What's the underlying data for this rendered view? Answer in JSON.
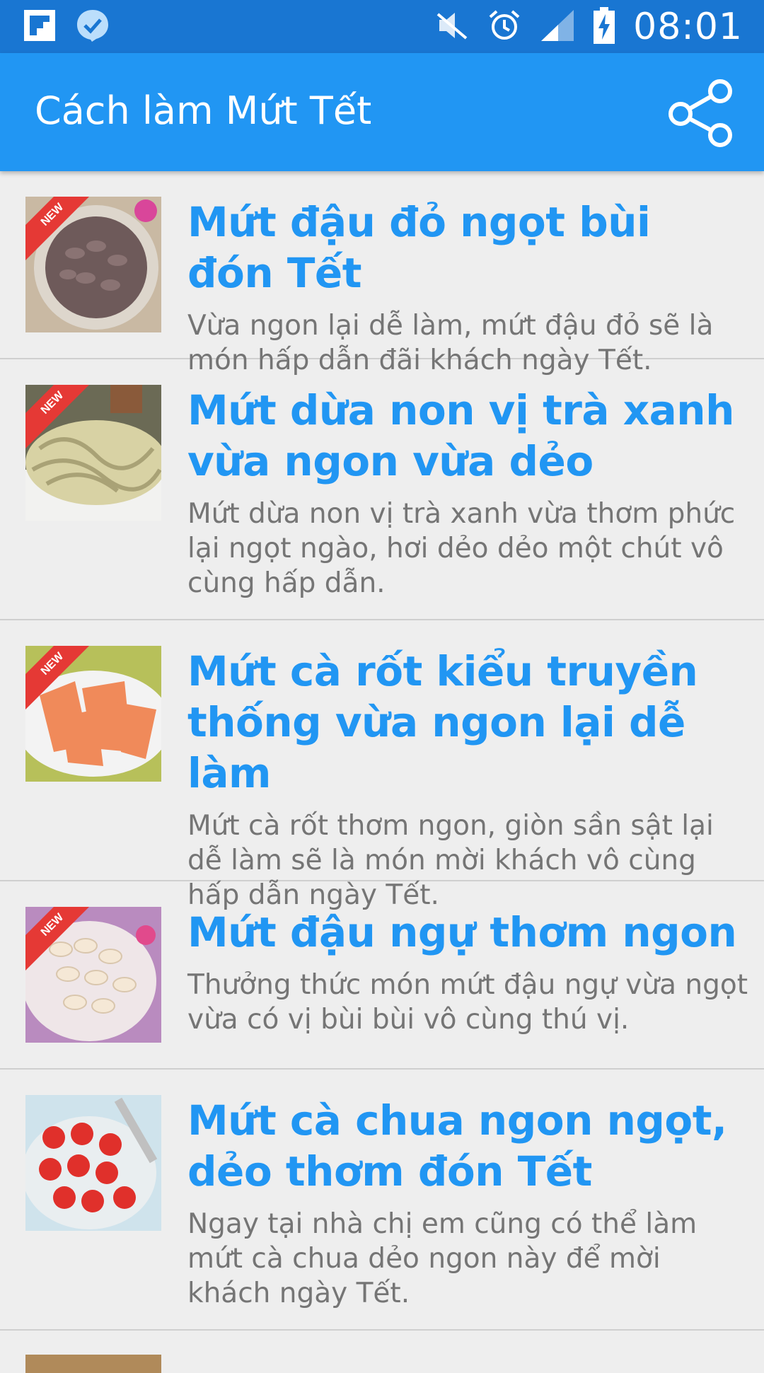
{
  "status_bar": {
    "time": "08:01",
    "left_icons": [
      "flipboard-icon",
      "messenger-check-icon"
    ],
    "right_icons": [
      "mute-icon",
      "alarm-icon",
      "signal-icon",
      "battery-charging-icon"
    ]
  },
  "app_bar": {
    "title": "Cách làm Mứt Tết",
    "share_icon": "share-icon",
    "color": "#2196f3"
  },
  "badge_label": "NEW",
  "items": [
    {
      "title": "Mứt đậu đỏ ngọt bùi đón Tết",
      "description": "Vừa ngon lại dễ làm, mứt đậu đỏ sẽ là món hấp dẫn đãi khách ngày Tết."
    },
    {
      "title": "Mứt dừa non vị trà xanh vừa ngon vừa dẻo",
      "description": "Mứt dừa non vị trà xanh vừa thơm phức lại ngọt ngào, hơi dẻo dẻo một chút vô cùng hấp dẫn."
    },
    {
      "title": "Mứt cà rốt kiểu truyền thống vừa ngon lại dễ làm",
      "description": "Mứt cà rốt thơm ngon, giòn sần sật lại dễ làm sẽ là món mời khách vô cùng hấp dẫn ngày Tết."
    },
    {
      "title": "Mứt đậu ngự thơm ngon",
      "description": "Thưởng thức món mứt đậu ngự vừa ngọt vừa có vị bùi bùi vô cùng thú vị."
    },
    {
      "title": "Mứt cà chua ngon ngọt, dẻo thơm đón Tết",
      "description": "Ngay tại nhà chị em cũng có thể làm mứt cà chua dẻo ngon này để mời khách ngày Tết."
    }
  ]
}
